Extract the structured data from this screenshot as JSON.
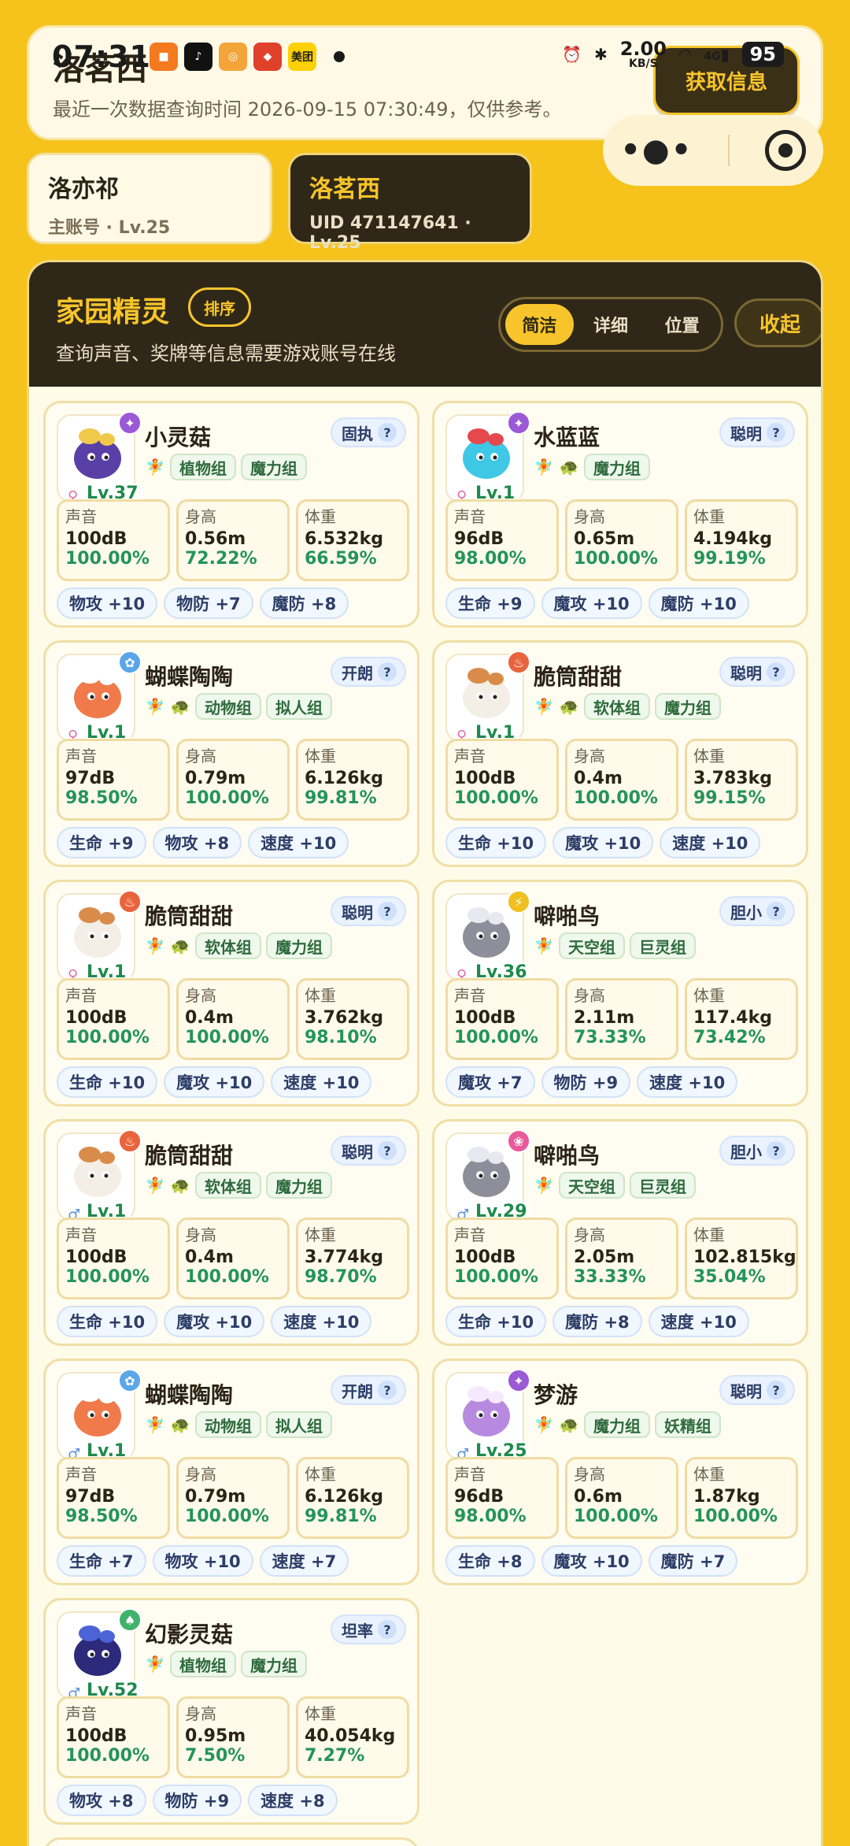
{
  "status_bar": {
    "time": "07:31",
    "apps": [
      {
        "name": "app-icon-1",
        "color": "#f47a20",
        "glyph": "■"
      },
      {
        "name": "tiktok-icon",
        "color": "#111111",
        "glyph": "♪"
      },
      {
        "name": "app-icon-3",
        "color": "#f3a53a",
        "glyph": "◎"
      },
      {
        "name": "app-icon-4",
        "color": "#e0412b",
        "glyph": "◆"
      },
      {
        "name": "meituan-icon",
        "color": "#ffd100",
        "glyph": "美团"
      }
    ],
    "speed_value": "2.00",
    "speed_unit": "KB/S",
    "network": "4G",
    "battery": "95"
  },
  "header": {
    "name": "洛茗西",
    "subtitle": "最近一次数据查询时间 2026-09-15 07:30:49，仅供参考。",
    "fetch_button": "获取信息"
  },
  "accounts": [
    {
      "name": "洛亦祁",
      "sub": "主账号 · Lv.25",
      "active": false
    },
    {
      "name": "洛茗西",
      "sub": "UID 471147641 · Lv.25",
      "active": true
    }
  ],
  "panel": {
    "title": "家园精灵",
    "sort_label": "排序",
    "subtitle": "查询声音、奖牌等信息需要游戏账号在线",
    "segments": [
      "简洁",
      "详细",
      "位置"
    ],
    "active_segment": 0,
    "collapse_label": "收起"
  },
  "labels": {
    "sound": "声音",
    "height": "身高",
    "weight": "体重"
  },
  "spirits": [
    {
      "name": "小灵菇",
      "level": "Lv.37",
      "gender": "♀",
      "element_color": "#9b59d6",
      "element_glyph": "✦",
      "nature": "固执",
      "emojis": [
        "🧚"
      ],
      "groups": [
        "植物组",
        "魔力组"
      ],
      "body_color": "#5a3fa6",
      "accent": "#f0c94a",
      "sound": "100dB",
      "sound_pct": "100.00%",
      "height": "0.56m",
      "height_pct": "72.22%",
      "weight": "6.532kg",
      "weight_pct": "66.59%",
      "bonuses": [
        "物攻 +10",
        "物防 +7",
        "魔防 +8"
      ]
    },
    {
      "name": "水蓝蓝",
      "level": "Lv.1",
      "gender": "♀",
      "element_color": "#9b59d6",
      "element_glyph": "✦",
      "nature": "聪明",
      "emojis": [
        "🧚",
        "🐢"
      ],
      "groups": [
        "魔力组"
      ],
      "body_color": "#3ec8e6",
      "accent": "#e5484d",
      "sound": "96dB",
      "sound_pct": "98.00%",
      "height": "0.65m",
      "height_pct": "100.00%",
      "weight": "4.194kg",
      "weight_pct": "99.19%",
      "bonuses": [
        "生命 +9",
        "魔攻 +10",
        "魔防 +10"
      ]
    },
    {
      "name": "蝴蝶陶陶",
      "level": "Lv.1",
      "gender": "♀",
      "element_color": "#5aa6e8",
      "element_glyph": "✿",
      "nature": "开朗",
      "emojis": [
        "🧚",
        "🐢"
      ],
      "groups": [
        "动物组",
        "拟人组"
      ],
      "body_color": "#f07a4a",
      "accent": "#ffffff",
      "sound": "97dB",
      "sound_pct": "98.50%",
      "height": "0.79m",
      "height_pct": "100.00%",
      "weight": "6.126kg",
      "weight_pct": "99.81%",
      "bonuses": [
        "生命 +9",
        "物攻 +8",
        "速度 +10"
      ]
    },
    {
      "name": "脆筒甜甜",
      "level": "Lv.1",
      "gender": "♀",
      "element_color": "#e8643c",
      "element_glyph": "♨",
      "nature": "聪明",
      "emojis": [
        "🧚",
        "🐢"
      ],
      "groups": [
        "软体组",
        "魔力组"
      ],
      "body_color": "#f3efe6",
      "accent": "#d98c4a",
      "sound": "100dB",
      "sound_pct": "100.00%",
      "height": "0.4m",
      "height_pct": "100.00%",
      "weight": "3.783kg",
      "weight_pct": "99.15%",
      "bonuses": [
        "生命 +10",
        "魔攻 +10",
        "速度 +10"
      ]
    },
    {
      "name": "脆筒甜甜",
      "level": "Lv.1",
      "gender": "♀",
      "element_color": "#e8643c",
      "element_glyph": "♨",
      "nature": "聪明",
      "emojis": [
        "🧚",
        "🐢"
      ],
      "groups": [
        "软体组",
        "魔力组"
      ],
      "body_color": "#f3efe6",
      "accent": "#d98c4a",
      "sound": "100dB",
      "sound_pct": "100.00%",
      "height": "0.4m",
      "height_pct": "100.00%",
      "weight": "3.762kg",
      "weight_pct": "98.10%",
      "bonuses": [
        "生命 +10",
        "魔攻 +10",
        "速度 +10"
      ]
    },
    {
      "name": "噼啪鸟",
      "level": "Lv.36",
      "gender": "♀",
      "element_color": "#f0c020",
      "element_glyph": "⚡",
      "nature": "胆小",
      "emojis": [
        "🧚"
      ],
      "groups": [
        "天空组",
        "巨灵组"
      ],
      "body_color": "#8e8e9a",
      "accent": "#e8e8f0",
      "sound": "100dB",
      "sound_pct": "100.00%",
      "height": "2.11m",
      "height_pct": "73.33%",
      "weight": "117.4kg",
      "weight_pct": "73.42%",
      "bonuses": [
        "魔攻 +7",
        "物防 +9",
        "速度 +10"
      ]
    },
    {
      "name": "脆筒甜甜",
      "level": "Lv.1",
      "gender": "♂",
      "element_color": "#e8643c",
      "element_glyph": "♨",
      "nature": "聪明",
      "emojis": [
        "🧚",
        "🐢"
      ],
      "groups": [
        "软体组",
        "魔力组"
      ],
      "body_color": "#f3efe6",
      "accent": "#d98c4a",
      "sound": "100dB",
      "sound_pct": "100.00%",
      "height": "0.4m",
      "height_pct": "100.00%",
      "weight": "3.774kg",
      "weight_pct": "98.70%",
      "bonuses": [
        "生命 +10",
        "魔攻 +10",
        "速度 +10"
      ]
    },
    {
      "name": "噼啪鸟",
      "level": "Lv.29",
      "gender": "♂",
      "element_color": "#e85a9a",
      "element_glyph": "❀",
      "nature": "胆小",
      "emojis": [
        "🧚"
      ],
      "groups": [
        "天空组",
        "巨灵组"
      ],
      "body_color": "#8e8e9a",
      "accent": "#e8e8f0",
      "sound": "100dB",
      "sound_pct": "100.00%",
      "height": "2.05m",
      "height_pct": "33.33%",
      "weight": "102.815kg",
      "weight_pct": "35.04%",
      "bonuses": [
        "生命 +10",
        "魔防 +8",
        "速度 +10"
      ]
    },
    {
      "name": "蝴蝶陶陶",
      "level": "Lv.1",
      "gender": "♂",
      "element_color": "#5aa6e8",
      "element_glyph": "✿",
      "nature": "开朗",
      "emojis": [
        "🧚",
        "🐢"
      ],
      "groups": [
        "动物组",
        "拟人组"
      ],
      "body_color": "#f07a4a",
      "accent": "#ffffff",
      "sound": "97dB",
      "sound_pct": "98.50%",
      "height": "0.79m",
      "height_pct": "100.00%",
      "weight": "6.126kg",
      "weight_pct": "99.81%",
      "bonuses": [
        "生命 +7",
        "物攻 +10",
        "速度 +7"
      ]
    },
    {
      "name": "梦游",
      "level": "Lv.25",
      "gender": "♂",
      "element_color": "#9b59d6",
      "element_glyph": "✦",
      "nature": "聪明",
      "emojis": [
        "🧚",
        "🐢"
      ],
      "groups": [
        "魔力组",
        "妖精组"
      ],
      "body_color": "#b78ae0",
      "accent": "#f6e9ff",
      "sound": "96dB",
      "sound_pct": "98.00%",
      "height": "0.6m",
      "height_pct": "100.00%",
      "weight": "1.87kg",
      "weight_pct": "100.00%",
      "bonuses": [
        "生命 +8",
        "魔攻 +10",
        "魔防 +7"
      ]
    },
    {
      "name": "幻影灵菇",
      "level": "Lv.52",
      "gender": "♂",
      "element_color": "#3fb36a",
      "element_glyph": "♠",
      "nature": "坦率",
      "emojis": [
        "🧚"
      ],
      "groups": [
        "植物组",
        "魔力组"
      ],
      "body_color": "#2c2a7a",
      "accent": "#4b63d6",
      "sound": "100dB",
      "sound_pct": "100.00%",
      "height": "0.95m",
      "height_pct": "7.50%",
      "weight": "40.054kg",
      "weight_pct": "7.27%",
      "bonuses": [
        "物攻 +8",
        "物防 +9",
        "速度 +8"
      ]
    }
  ]
}
